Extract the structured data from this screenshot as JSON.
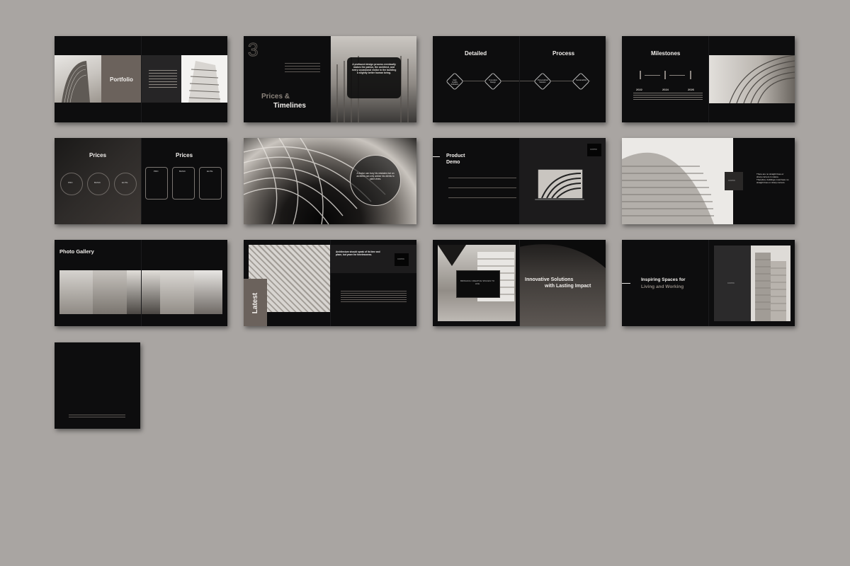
{
  "slides": {
    "s1": {
      "title": "Portfolio"
    },
    "s2": {
      "number": "3",
      "title_line1": "Prices &",
      "title_line2": "Timelines",
      "quote": "A profound design process eventually makes the patron, the architect, and every occasional visitor in the building a slightly better human being."
    },
    "s3": {
      "left_title": "Detailed",
      "right_title": "Process",
      "steps": [
        "High Quality Solutions",
        "Innovative Design",
        "Personalized Solution",
        "Sustainability"
      ]
    },
    "s4": {
      "title": "Milestones",
      "years": [
        "2022",
        "2024",
        "2026"
      ]
    },
    "s5": {
      "left_title": "Prices",
      "right_title": "Prices",
      "circle_labels": [
        "PRO",
        "BASIC",
        "ELITE"
      ],
      "pill_labels": [
        "PRO",
        "BASIC",
        "ELITE"
      ]
    },
    "s6": {
      "quote": "A doctor can bury his mistakes but an architect can only advise his clients to plant vines."
    },
    "s7": {
      "title_line1": "Product",
      "title_line2": "Demo",
      "logo": "CONTIN"
    },
    "s8": {
      "logo": "CONTIN",
      "text": "There are no straight lines or sharp corners in nature. Therefore, buildings must have no straight lines or sharp corners."
    },
    "s9": {
      "title": "Photo Gallery"
    },
    "s10": {
      "side_label": "Latest",
      "quote": "Architecture should speak of its time and place, but yearn for timelessness.",
      "logo": "CONTIN"
    },
    "s11": {
      "box_text": "BRINGING CREATIVE SPACES TO LIFE",
      "title_line1": "Innovative Solutions",
      "title_line2": "with Lasting Impact"
    },
    "s12": {
      "title_line1": "Inspiring Spaces for",
      "title_line2": "Living and Working",
      "logo": "CONTIN"
    }
  },
  "colors": {
    "background": "#a9a5a2",
    "slide": "#0d0d0e",
    "accent_taupe": "#6b625c",
    "text_light": "#f2efec",
    "text_muted": "#8a847e"
  }
}
